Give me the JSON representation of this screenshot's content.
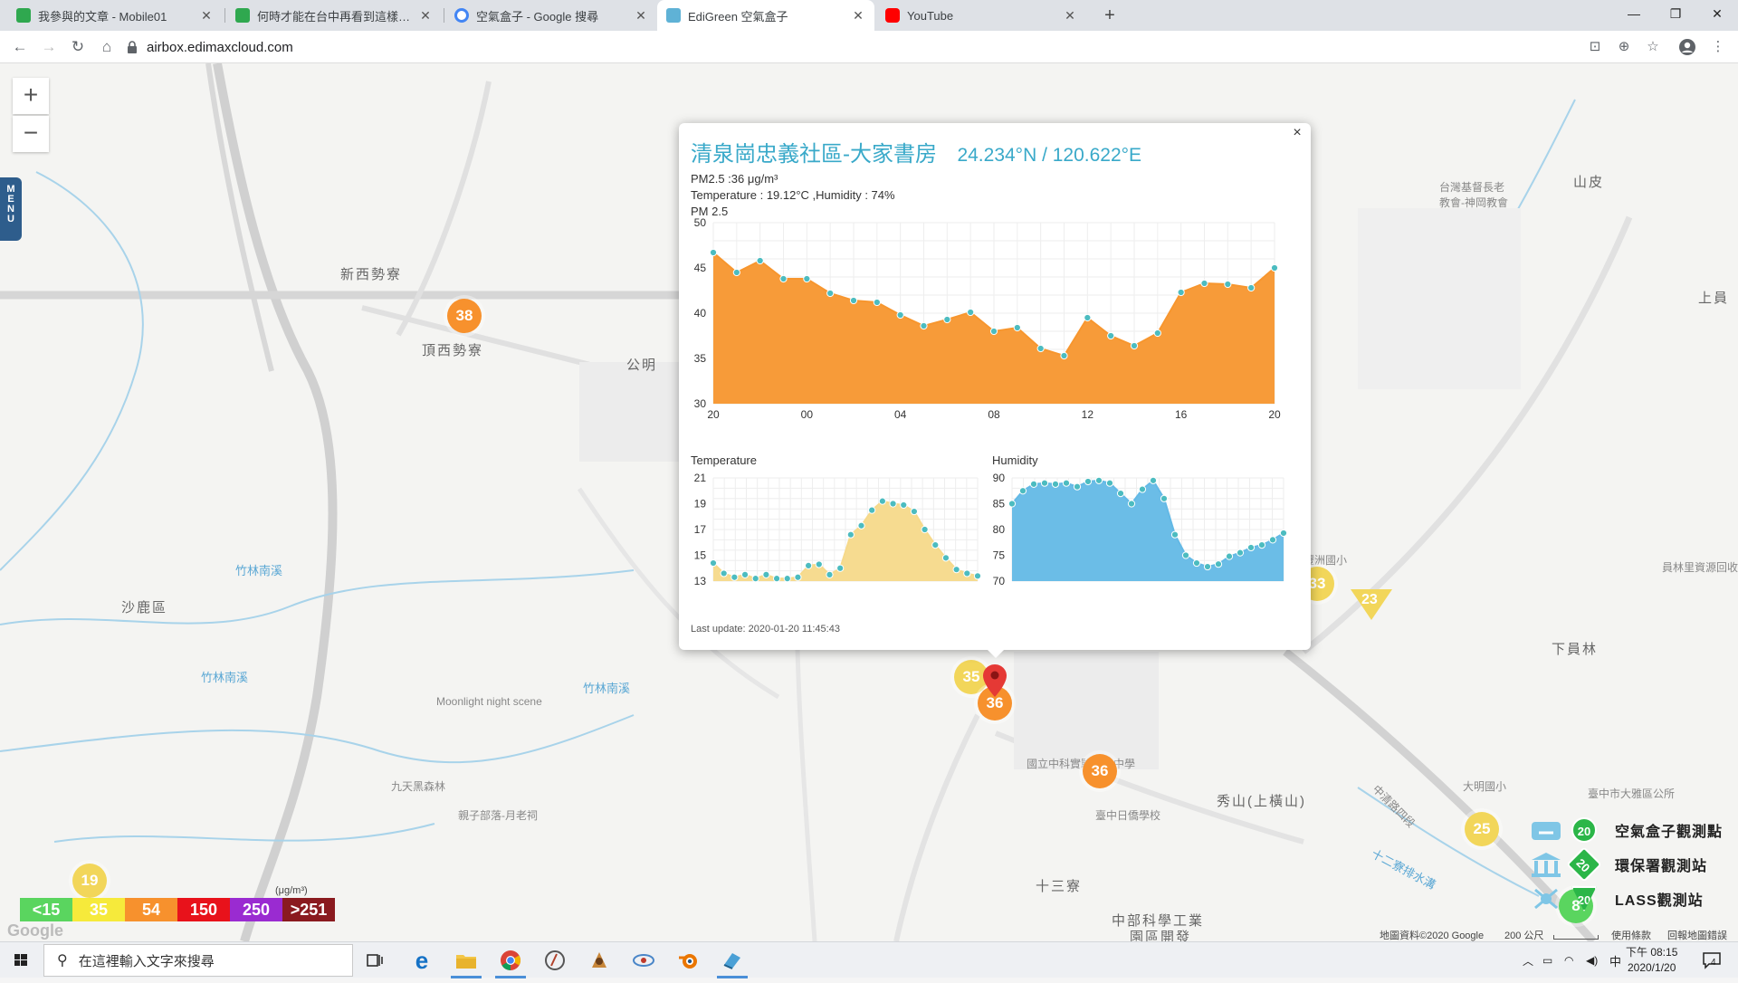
{
  "browser": {
    "tabs": [
      {
        "title": "我參與的文章 - Mobile01",
        "icon_color": "#2fa84f",
        "active": false
      },
      {
        "title": "何時才能在台中再看到這樣的藍天",
        "icon_color": "#2fa84f",
        "active": false
      },
      {
        "title": "空氣盒子 - Google 搜尋",
        "icon_color": "#4285f4",
        "active": false
      },
      {
        "title": "EdiGreen 空氣盒子",
        "icon_color": "#5fb2d6",
        "active": true
      },
      {
        "title": "YouTube",
        "icon_color": "#ff0000",
        "active": false
      }
    ],
    "url": "airbox.edimaxcloud.com"
  },
  "map": {
    "labels": [
      {
        "text": "新西勢寮",
        "kind": "place"
      },
      {
        "text": "頂西勢寮",
        "kind": "place"
      },
      {
        "text": "公明",
        "kind": "place"
      },
      {
        "text": "沙鹿區",
        "kind": "place"
      },
      {
        "text": "山皮",
        "kind": "place"
      },
      {
        "text": "上員",
        "kind": "place"
      },
      {
        "text": "下員林",
        "kind": "place"
      },
      {
        "text": "秀山(上橫山)",
        "kind": "place"
      },
      {
        "text": "十三寮",
        "kind": "place"
      },
      {
        "text": "中部科學工業",
        "kind": "place"
      },
      {
        "text": "園區開發",
        "kind": "place"
      },
      {
        "text": "Moonlight night scene",
        "kind": "poi"
      },
      {
        "text": "九天黑森林",
        "kind": "poi"
      },
      {
        "text": "親子部落-月老祠",
        "kind": "poi"
      },
      {
        "text": "國立中科實驗高級中學",
        "kind": "poi"
      },
      {
        "text": "臺中日僑學校",
        "kind": "poi"
      },
      {
        "text": "竹林南溪",
        "kind": "water"
      },
      {
        "text": "竹林南溪",
        "kind": "water"
      },
      {
        "text": "竹林南溪",
        "kind": "water"
      },
      {
        "text": "台灣基督長老教會-神岡教會",
        "kind": "poi"
      },
      {
        "text": "豐洲國小",
        "kind": "poi"
      },
      {
        "text": "中清路四段",
        "kind": "road"
      },
      {
        "text": "十二寮排水溝",
        "kind": "water"
      },
      {
        "text": "大明國小",
        "kind": "poi"
      },
      {
        "text": "臺中市大雅區公所",
        "kind": "poi"
      },
      {
        "text": "員林里資源回收",
        "kind": "poi"
      }
    ],
    "markers": [
      {
        "value": "38",
        "color": "orange"
      },
      {
        "value": "35",
        "color": "yellow"
      },
      {
        "value": "36",
        "color": "orange"
      },
      {
        "value": "36",
        "color": "orange"
      },
      {
        "value": "33",
        "color": "yellow"
      },
      {
        "value": "25",
        "color": "yellow"
      },
      {
        "value": "19",
        "color": "yellow"
      },
      {
        "value": "8",
        "color": "green"
      }
    ],
    "triangle_marker": {
      "value": "23"
    },
    "zoom_in": "+",
    "zoom_out": "−",
    "menu_label": "MENU",
    "legend": {
      "unit": "(μg/m³)",
      "cells": [
        {
          "label": "<15",
          "color": "#5ad55f"
        },
        {
          "label": "35",
          "color": "#f6ea3b"
        },
        {
          "label": "54",
          "color": "#f7912d"
        },
        {
          "label": "150",
          "color": "#e8121b"
        },
        {
          "label": "250",
          "color": "#9a2bd1"
        },
        {
          "label": ">251",
          "color": "#8a1a1f"
        }
      ]
    },
    "station_legend": [
      {
        "label": "空氣盒子觀測點",
        "badge": "20"
      },
      {
        "label": "環保署觀測站",
        "badge": "20"
      },
      {
        "label": "LASS觀測站",
        "badge": "20"
      }
    ],
    "attribution": {
      "data": "地圖資料©2020 Google",
      "scale": "200 公尺",
      "terms": "使用條款",
      "report": "回報地圖錯誤"
    },
    "google_logo": "Google"
  },
  "popup": {
    "title": "清泉崗忠義社區-大家書房",
    "coords": "24.234°N / 120.622°E",
    "pm25_line": "PM2.5 :36 μg/m³",
    "weather_line": "Temperature : 19.12°C ,Humidity : 74%",
    "pm_chart_title": "PM 2.5",
    "temp_chart_title": "Temperature",
    "hum_chart_title": "Humidity",
    "last_update": "Last update: 2020-01-20 11:45:43",
    "close": "×"
  },
  "chart_data": [
    {
      "type": "area",
      "title": "PM 2.5",
      "x_ticks": [
        "20",
        "00",
        "04",
        "08",
        "12",
        "16",
        "20"
      ],
      "ylim": [
        30,
        50
      ],
      "y_ticks": [
        30,
        35,
        40,
        45,
        50
      ],
      "color": "#f7962e",
      "point_color": "#4cbcc0",
      "values": [
        46.7,
        44.5,
        45.8,
        43.8,
        43.8,
        42.2,
        41.4,
        41.2,
        39.8,
        38.6,
        39.3,
        40.1,
        38,
        38.4,
        36.1,
        35.3,
        39.5,
        37.5,
        36.4,
        37.8,
        42.3,
        43.3,
        43.2,
        42.8,
        45
      ]
    },
    {
      "type": "area",
      "title": "Temperature",
      "ylim": [
        13,
        21
      ],
      "y_ticks": [
        13,
        15,
        17,
        19,
        21
      ],
      "color": "#f6d98a",
      "point_color": "#4cbcc0",
      "values": [
        14.4,
        13.6,
        13.3,
        13.5,
        13.2,
        13.5,
        13.2,
        13.2,
        13.3,
        14.2,
        14.3,
        13.5,
        14.0,
        16.6,
        17.3,
        18.5,
        19.2,
        19.0,
        18.9,
        18.4,
        17.0,
        15.8,
        14.8,
        13.9,
        13.6,
        13.4
      ]
    },
    {
      "type": "area",
      "title": "Humidity",
      "ylim": [
        70,
        90
      ],
      "y_ticks": [
        70,
        75,
        80,
        85,
        90
      ],
      "color": "#63b9e6",
      "point_color": "#4cbcc0",
      "values": [
        85,
        87.5,
        88.8,
        89.0,
        88.8,
        89.0,
        88.3,
        89.3,
        89.5,
        89.0,
        87.0,
        85.0,
        87.8,
        89.5,
        86.0,
        79.0,
        75.0,
        73.5,
        72.8,
        73.3,
        74.8,
        75.5,
        76.5,
        77.0,
        78.0,
        79.3
      ]
    }
  ],
  "taskbar": {
    "search_placeholder": "在這裡輸入文字來搜尋",
    "time": "下午 08:15",
    "date": "2020/1/20",
    "ime": "中",
    "notification_count": "4"
  }
}
